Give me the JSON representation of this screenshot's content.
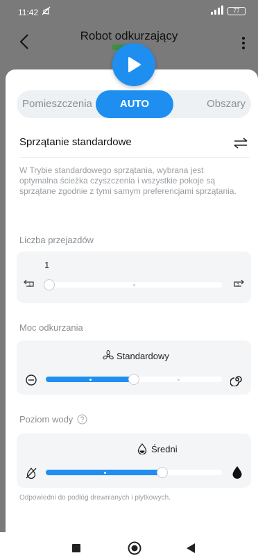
{
  "status": {
    "time": "11:42",
    "battery": "77"
  },
  "header": {
    "title": "Robot odkurzający"
  },
  "modes": {
    "left": "Pomieszczenia",
    "active": "AUTO",
    "right": "Obszary"
  },
  "mode_section": {
    "title": "Sprzątanie standardowe",
    "description": "W Trybie standardowego sprzątania, wybrana jest optymalna ścieżka czyszczenia i wszystkie pokoje są sprzątane zgodnie z tymi samym preferencjami sprzątania."
  },
  "passes": {
    "label": "Liczba przejazdów",
    "value": "1",
    "min_icon": "1",
    "max_icon": "3",
    "level_fraction": 0
  },
  "suction": {
    "label": "Moc odkurzania",
    "value": "Standardowy",
    "level_fraction": 0.5
  },
  "water": {
    "label": "Poziom wody",
    "value": "Średni",
    "level_fraction": 0.66
  },
  "hint": "Odpowiedni do podłóg drewnianych i płytkowych.",
  "colors": {
    "accent": "#1e8ff0",
    "card": "#f3f5f7",
    "muted": "#9a9ea3"
  }
}
